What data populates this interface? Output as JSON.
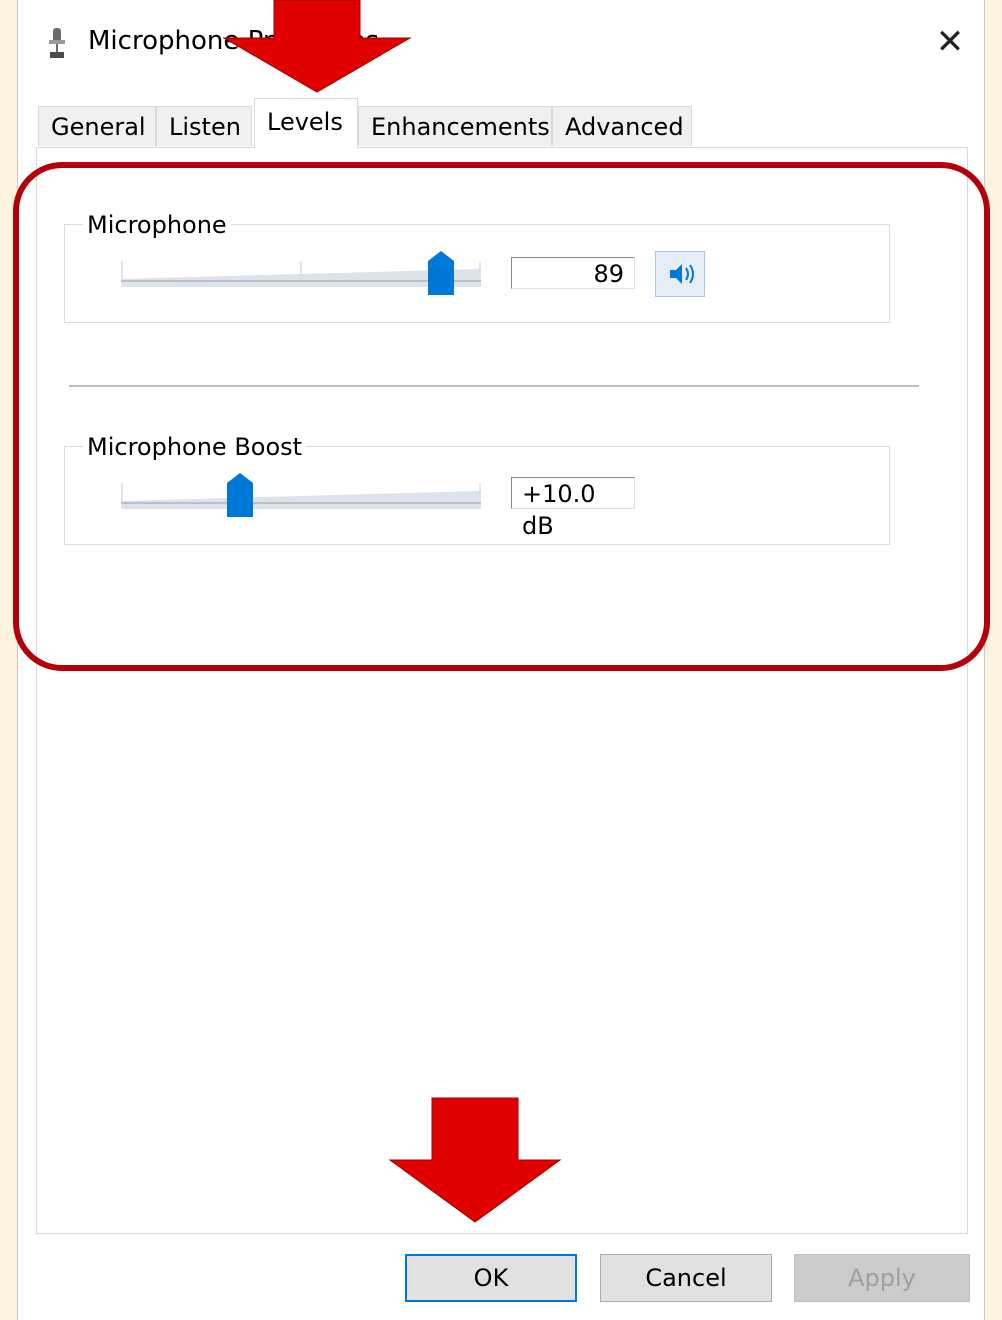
{
  "window": {
    "title": "Microphone Properties",
    "close_icon": "close-icon"
  },
  "tabs": [
    {
      "label": "General"
    },
    {
      "label": "Listen"
    },
    {
      "label": "Levels",
      "active": true
    },
    {
      "label": "Enhancements"
    },
    {
      "label": "Advanced"
    }
  ],
  "levels": {
    "microphone": {
      "label": "Microphone",
      "value": "89",
      "level_percent": 89,
      "mute_icon": "speaker-icon"
    },
    "boost": {
      "label": "Microphone Boost",
      "value": "+10.0 dB",
      "level_fraction": 0.33
    }
  },
  "buttons": {
    "ok": "OK",
    "cancel": "Cancel",
    "apply": "Apply"
  },
  "colors": {
    "accent": "#0078d7",
    "annotation_red": "#e00000",
    "highlight_frame": "#b3000b"
  }
}
